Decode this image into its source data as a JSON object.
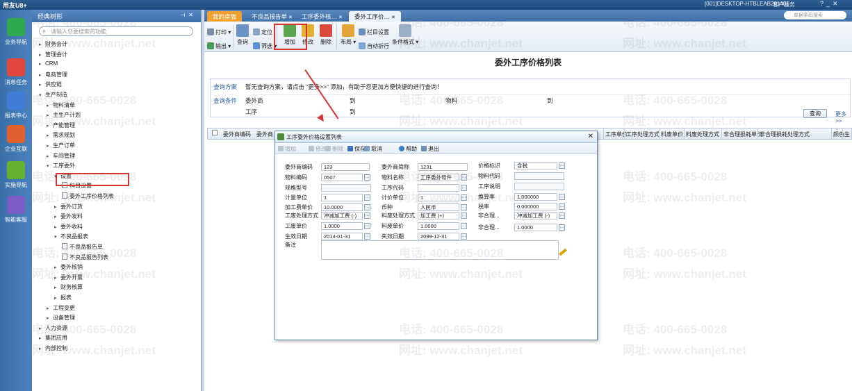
{
  "app": {
    "logo": "用友U8+",
    "machine": "[001]DESKTOP-HTBLEAB201401",
    "service_label": "客户服务",
    "search_placeholder": "单据条码搜索"
  },
  "left_rail": [
    {
      "label": "业务导航",
      "icon": "business-nav-icon",
      "color": "#2fa84f"
    },
    {
      "label": "消息任务",
      "icon": "message-task-icon",
      "color": "#e0463c"
    },
    {
      "label": "报表中心",
      "icon": "report-center-icon",
      "color": "#3d7dd6"
    },
    {
      "label": "企业互联",
      "icon": "enterprise-link-icon",
      "color": "#e06030"
    },
    {
      "label": "实施导航",
      "icon": "implement-nav-icon",
      "color": "#66b032"
    },
    {
      "label": "智能客服",
      "icon": "smart-service-icon",
      "color": "#7b5cc4"
    }
  ],
  "nav": {
    "title": "经典树形",
    "search_placeholder": "请输入您要搜索的功能",
    "items": [
      {
        "label": "财务会计",
        "level": 0,
        "arrow": "▸"
      },
      {
        "label": "管理会计",
        "level": 0,
        "arrow": "▸"
      },
      {
        "label": "CRM",
        "level": 0,
        "arrow": "▸"
      },
      {
        "label": "电商管理",
        "level": 0,
        "arrow": "▸"
      },
      {
        "label": "供应链",
        "level": 0,
        "arrow": "▸"
      },
      {
        "label": "生产制造",
        "level": 0,
        "arrow": "▾"
      },
      {
        "label": "物料清单",
        "level": 1,
        "arrow": "▸"
      },
      {
        "label": "主生产计划",
        "level": 1,
        "arrow": "▸"
      },
      {
        "label": "产能管理",
        "level": 1,
        "arrow": "▸"
      },
      {
        "label": "需求规划",
        "level": 1,
        "arrow": "▸"
      },
      {
        "label": "生产订单",
        "level": 1,
        "arrow": "▸"
      },
      {
        "label": "车间管理",
        "level": 1,
        "arrow": "▸"
      },
      {
        "label": "工序委外",
        "level": 1,
        "arrow": "▾"
      },
      {
        "label": "设置",
        "level": 2,
        "arrow": "▾"
      },
      {
        "label": "科目设置",
        "level": 3,
        "arrow": "doc"
      },
      {
        "label": "委外工序价格列表",
        "level": 3,
        "arrow": "doc"
      },
      {
        "label": "委外订货",
        "level": 2,
        "arrow": "▸"
      },
      {
        "label": "委外发料",
        "level": 2,
        "arrow": "▸"
      },
      {
        "label": "委外收料",
        "level": 2,
        "arrow": "▸"
      },
      {
        "label": "不良品报表",
        "level": 2,
        "arrow": "▾"
      },
      {
        "label": "不良品报告单",
        "level": 3,
        "arrow": "doc"
      },
      {
        "label": "不良品报告列表",
        "level": 3,
        "arrow": "doc"
      },
      {
        "label": "委外核销",
        "level": 2,
        "arrow": "▸"
      },
      {
        "label": "委外开票",
        "level": 2,
        "arrow": "▸"
      },
      {
        "label": "财务核算",
        "level": 2,
        "arrow": "▸"
      },
      {
        "label": "报表",
        "level": 2,
        "arrow": "▸"
      },
      {
        "label": "工程变更",
        "level": 1,
        "arrow": "▸"
      },
      {
        "label": "设备管理",
        "level": 1,
        "arrow": "▸"
      },
      {
        "label": "人力资源",
        "level": 0,
        "arrow": "▸"
      },
      {
        "label": "集团应用",
        "level": 0,
        "arrow": "▸"
      },
      {
        "label": "内部控制",
        "level": 0,
        "arrow": "▸"
      }
    ]
  },
  "tabs": [
    {
      "label": "我的桌面",
      "style": "home"
    },
    {
      "label": "不良品报告单",
      "style": ""
    },
    {
      "label": "工序委外核…",
      "style": ""
    },
    {
      "label": "委外工序价…",
      "style": "active"
    }
  ],
  "toolbar": {
    "print": "打印",
    "export": "输出",
    "query": "查询",
    "locate": "定位",
    "filter": "筛选",
    "add": "增加",
    "edit": "修改",
    "delete": "删除",
    "layout": "布局",
    "column_settings": "栏目设置",
    "auto_wrap": "自动折行",
    "condition_format": "条件格式"
  },
  "main": {
    "title": "委外工序价格列表",
    "query_scheme_label": "查询方案",
    "query_scheme_hint": "暂无查询方案，请点击 “更多>>” 添加，有助于您更加方便快捷的进行查询！",
    "query_cond_label": "查询条件",
    "vendor_label": "委外商",
    "to_label": "到",
    "material_label": "物料",
    "to_label2": "到",
    "process_label": "工序",
    "to_label3": "到",
    "query_button": "查询",
    "more_link": "更多>>",
    "grid_left_headers": [
      "委外商编码",
      "委外商"
    ],
    "grid_right_headers": [
      "工序单价",
      "工序处理方式",
      "料废单价",
      "料废处理方式",
      "非合理损耗单价",
      "非合理损耗处理方式",
      "颜色",
      "生"
    ]
  },
  "dialog": {
    "title": "工序委外价格设置列表",
    "toolbar": {
      "add": "增加",
      "edit": "修改",
      "delete": "删除",
      "save": "保存",
      "cancel": "取消",
      "help": "帮助",
      "exit": "退出"
    },
    "fields": {
      "vendor_code_label": "委外商编码",
      "vendor_code": "123",
      "vendor_abbr_label": "委外商简称",
      "vendor_abbr": "1231",
      "price_flag_label": "价格标识",
      "price_flag": "含税",
      "material_code_label": "物料编码",
      "material_code": "0507",
      "material_name_label": "物料名称",
      "material_name": "工序委外母件",
      "material_code2_label": "物料代码",
      "material_code2": "",
      "spec_label": "规格型号",
      "spec": "",
      "process_code_label": "工序代码",
      "process_code": "",
      "process_desc_label": "工序说明",
      "process_desc": "",
      "unit_label": "计量单位",
      "unit": "1",
      "price_unit_label": "计价单位",
      "price_unit": "1",
      "conv_rate_label": "换算率",
      "conv_rate": "1.000000",
      "process_price_label": "加工费单价",
      "process_price": "10.0000",
      "currency_label": "币种",
      "currency": "人民币",
      "tax_rate_label": "税率",
      "tax_rate": "0.000000",
      "process_method_label": "工废处理方式",
      "process_method": "冲减加工费 (-)",
      "scrap_method_label": "料废处理方式",
      "scrap_method": "加工费 (+)",
      "unreasonable1_label": "非合理...",
      "unreasonable1": "冲减加工费 (-)",
      "process_unit_price_label": "工废单价",
      "process_unit_price": "1.0000",
      "scrap_price_label": "料废单价",
      "scrap_price": "1.0000",
      "unreasonable2_label": "非合理...",
      "unreasonable2": "1.0000",
      "effective_date_label": "生效日期",
      "effective_date": "2014-01-31",
      "expire_date_label": "失效日期",
      "expire_date": "2099-12-31",
      "remark_label": "备注"
    }
  },
  "watermark": {
    "phone": "电话: 400-665-0028",
    "site": "网址: www.chanjet.net"
  }
}
